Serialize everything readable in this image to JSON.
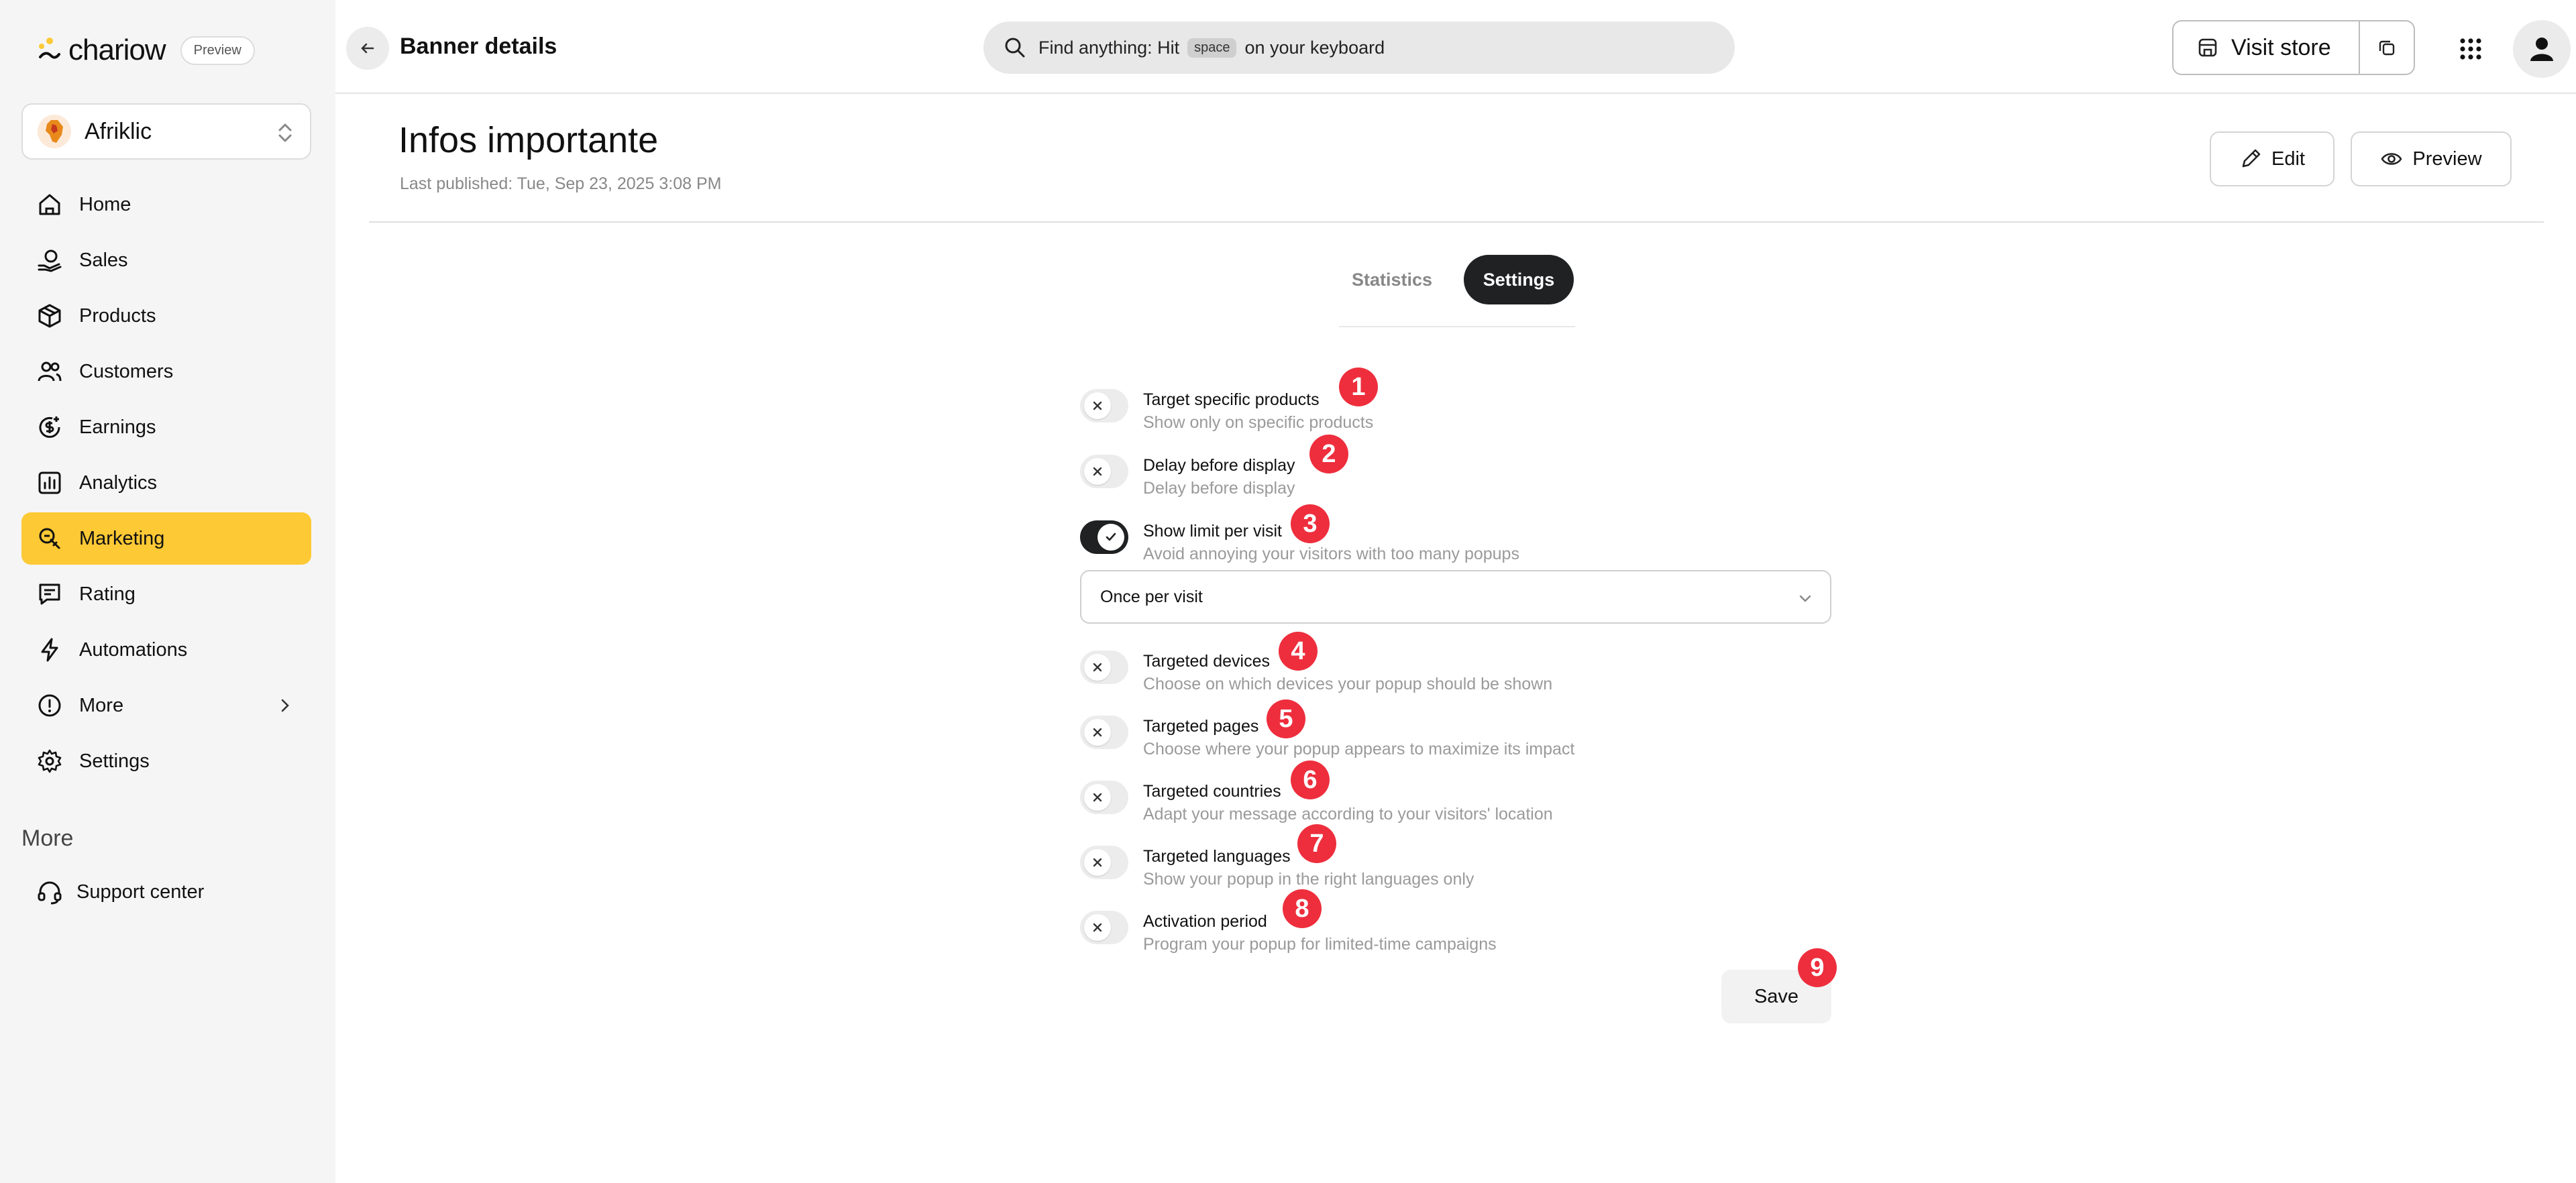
{
  "brand": {
    "logo_text": "chariow",
    "badge": "Preview",
    "accent": "#fdc935",
    "dark": "#1f2123",
    "marker": "#ee2e3d"
  },
  "store": {
    "name": "Afriklic",
    "avatar_text": "AFRIKLIC"
  },
  "sidebar": {
    "items": [
      {
        "label": "Home",
        "icon": "home-icon"
      },
      {
        "label": "Sales",
        "icon": "sales-icon"
      },
      {
        "label": "Products",
        "icon": "box-icon"
      },
      {
        "label": "Customers",
        "icon": "users-icon"
      },
      {
        "label": "Earnings",
        "icon": "dollar-icon"
      },
      {
        "label": "Analytics",
        "icon": "chart-icon"
      },
      {
        "label": "Marketing",
        "icon": "megaphone-icon",
        "active": true
      },
      {
        "label": "Rating",
        "icon": "message-icon"
      },
      {
        "label": "Automations",
        "icon": "bolt-icon"
      },
      {
        "label": "More",
        "icon": "info-icon"
      },
      {
        "label": "Settings",
        "icon": "gear-icon"
      }
    ],
    "more_heading": "More",
    "support_label": "Support center"
  },
  "topbar": {
    "title": "Banner details",
    "search_prefix": "Find anything: Hit",
    "search_key": "space",
    "search_suffix": "on your keyboard",
    "visit_store": "Visit store"
  },
  "page": {
    "title": "Infos importante",
    "published": "Last published: Tue, Sep 23, 2025 3:08 PM",
    "edit_label": "Edit",
    "preview_label": "Preview"
  },
  "tabs": {
    "statistics": "Statistics",
    "settings": "Settings",
    "active": "Settings"
  },
  "settings": [
    {
      "title": "Target specific products",
      "desc": "Show only on specific products",
      "on": false,
      "marker": "1"
    },
    {
      "title": "Delay before display",
      "desc": "Delay before display",
      "on": false,
      "marker": "2"
    },
    {
      "title": "Show limit per visit",
      "desc": "Avoid annoying your visitors with too many popups",
      "on": true,
      "marker": "3"
    },
    {
      "title": "Targeted devices",
      "desc": "Choose on which devices your popup should be shown",
      "on": false,
      "marker": "4"
    },
    {
      "title": "Targeted pages",
      "desc": "Choose where your popup appears to maximize its impact",
      "on": false,
      "marker": "5"
    },
    {
      "title": "Targeted countries",
      "desc": "Adapt your message according to your visitors' location",
      "on": false,
      "marker": "6"
    },
    {
      "title": "Targeted languages",
      "desc": "Show your popup in the right languages only",
      "on": false,
      "marker": "7"
    },
    {
      "title": "Activation period",
      "desc": "Program your popup for limited-time campaigns",
      "on": false,
      "marker": "8"
    }
  ],
  "limit_select": {
    "value": "Once per visit"
  },
  "save": {
    "label": "Save",
    "marker": "9"
  }
}
